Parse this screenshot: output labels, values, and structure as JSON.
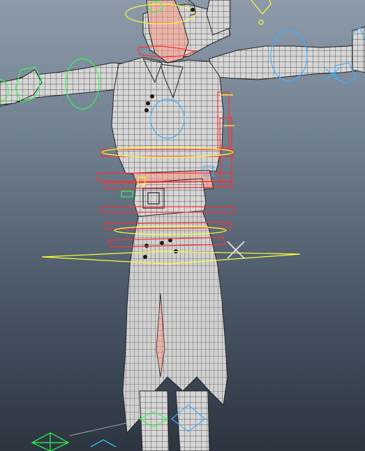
{
  "viewport": {
    "background_top": "#8c9aaa",
    "background_bottom": "#2c3540"
  },
  "model": {
    "mesh_color": "#d4d4d4",
    "wire_color": "#2a2a2a",
    "skin_color": "#e6b2a8"
  },
  "controls": {
    "red": "#ff3030",
    "yellow": "#ffff30",
    "green": "#30ff50",
    "blue": "#40b0ff"
  }
}
